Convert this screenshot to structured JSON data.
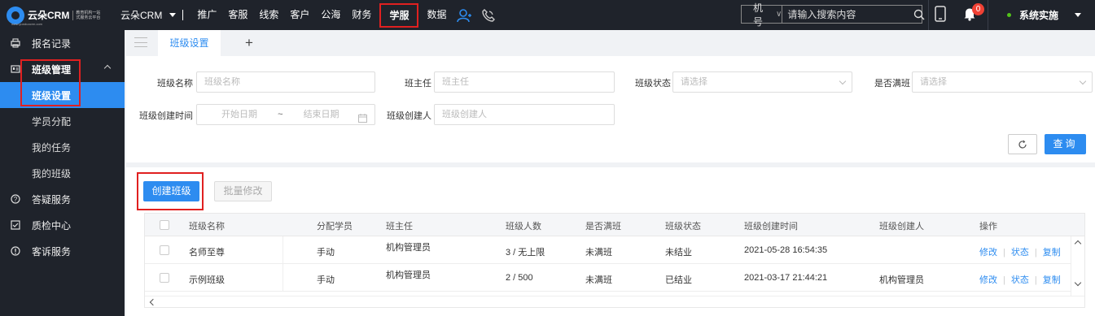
{
  "topbar": {
    "logo_text": "云朵CRM",
    "logo_sub1": "教育机构一站",
    "logo_sub2": "式服务云平台",
    "logo_site": "www.yunduocrm.com",
    "app_name": "云朵CRM",
    "nav": [
      "推广",
      "客服",
      "线索",
      "客户",
      "公海",
      "财务",
      "学服",
      "数据"
    ],
    "active_nav": "学服",
    "search_select": "手机号码",
    "search_placeholder": "请输入搜索内容",
    "notification_count": "0",
    "user_name": "系统实施"
  },
  "sidebar": {
    "items": [
      {
        "label": "报名记录"
      },
      {
        "label": "班级管理"
      },
      {
        "label": "答疑服务"
      },
      {
        "label": "质检中心"
      },
      {
        "label": "客诉服务"
      }
    ],
    "sub_items": [
      {
        "label": "班级设置"
      },
      {
        "label": "学员分配"
      },
      {
        "label": "我的任务"
      },
      {
        "label": "我的班级"
      }
    ]
  },
  "tabs": {
    "active_tab": "班级设置"
  },
  "filters": {
    "class_name_label": "班级名称",
    "class_name_placeholder": "班级名称",
    "teacher_label": "班主任",
    "teacher_placeholder": "班主任",
    "status_label": "班级状态",
    "status_placeholder": "请选择",
    "full_label": "是否满班",
    "full_placeholder": "请选择",
    "created_time_label": "班级创建时间",
    "start_date_placeholder": "开始日期",
    "date_sep": "~",
    "end_date_placeholder": "结束日期",
    "creator_label": "班级创建人",
    "creator_placeholder": "班级创建人",
    "query_button": "查询"
  },
  "actions": {
    "create_button": "创建班级",
    "batch_edit_button": "批量修改"
  },
  "table": {
    "columns": [
      "班级名称",
      "分配学员",
      "班主任",
      "班级人数",
      "是否满班",
      "班级状态",
      "班级创建时间",
      "班级创建人",
      "操作"
    ],
    "rows": [
      {
        "name": "名师至尊",
        "assign": "手动",
        "teacher": "机构管理员",
        "count": "3 / 无上限",
        "full": "未满班",
        "status": "未结业",
        "created": "2021-05-28 16:54:35",
        "creator": "",
        "ops": [
          "修改",
          "状态",
          "复制"
        ]
      },
      {
        "name": "示例班级",
        "assign": "手动",
        "teacher": "机构管理员",
        "count": "2 / 500",
        "full": "未满班",
        "status": "已结业",
        "created": "2021-03-17 21:44:21",
        "creator": "机构管理员",
        "ops": [
          "修改",
          "状态",
          "复制"
        ]
      }
    ]
  },
  "colors": {
    "accent": "#2d8cf0",
    "topbar_bg": "#1f232b",
    "highlight_box": "#e02020",
    "badge": "#f04134"
  }
}
